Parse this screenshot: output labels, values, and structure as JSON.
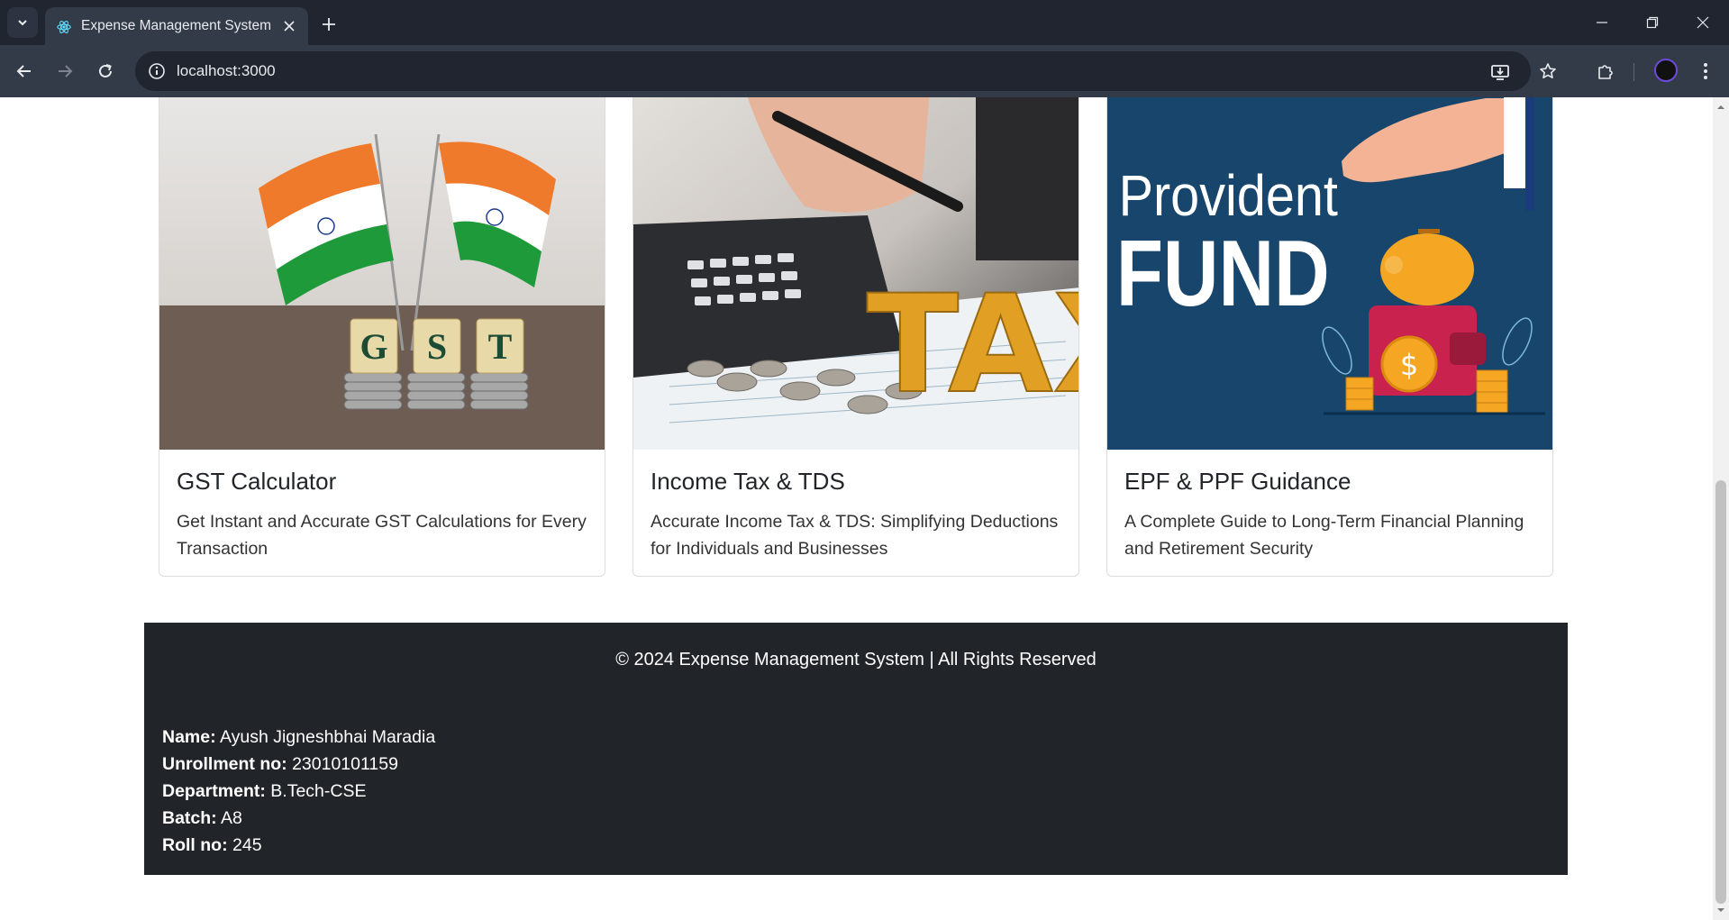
{
  "browser": {
    "tab_title": "Expense Management System",
    "url": "localhost:3000"
  },
  "cards": [
    {
      "title": "GST Calculator",
      "text": "Get Instant and Accurate GST Calculations for Every Transaction",
      "image_letters": [
        "G",
        "S",
        "T"
      ]
    },
    {
      "title": "Income Tax & TDS",
      "text": "Accurate Income Tax & TDS: Simplifying Deductions for Individuals and Businesses",
      "image_word": "TAX"
    },
    {
      "title": "EPF & PPF Guidance",
      "text": "A Complete Guide to Long-Term Financial Planning and Retirement Security",
      "image_line1": "Provident",
      "image_line2": "FUND"
    }
  ],
  "footer": {
    "copyright": "© 2024 Expense Management System | All Rights Reserved",
    "name_label": "Name:",
    "name": "Ayush Jigneshbhai Maradia",
    "enroll_label": "Unrollment no:",
    "enroll": "23010101159",
    "dept_label": "Department:",
    "dept": "B.Tech-CSE",
    "batch_label": "Batch:",
    "batch": "A8",
    "roll_label": "Roll no:",
    "roll": "245"
  },
  "colors": {
    "chrome_dark": "#202530",
    "chrome_toolbar": "#333a48",
    "footer_bg": "#212529",
    "epf_bg": "#17456b"
  }
}
